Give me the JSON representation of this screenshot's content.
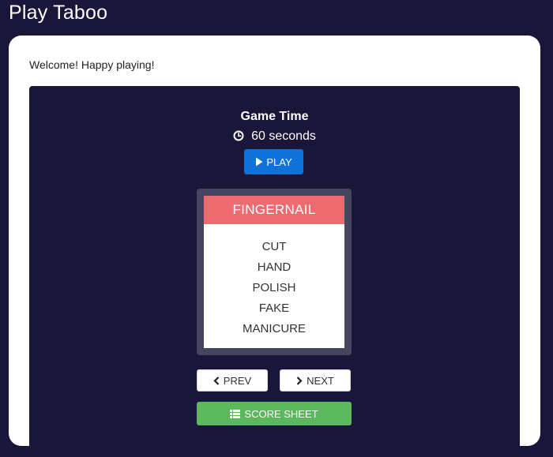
{
  "app": {
    "title": "Play Taboo"
  },
  "welcome_message": "Welcome! Happy playing!",
  "game_time": {
    "title": "Game Time",
    "value": "60 seconds"
  },
  "buttons": {
    "play": "PLAY",
    "prev": "PREV",
    "next": "NEXT",
    "score_sheet": "SCORE SHEET"
  },
  "card": {
    "word": "FINGERNAIL",
    "forbidden": [
      "CUT",
      "HAND",
      "POLISH",
      "FAKE",
      "MANICURE"
    ]
  },
  "icons": {
    "clock": "clock-icon",
    "play": "play-icon",
    "prev": "chevron-left-icon",
    "next": "chevron-right-icon",
    "score_sheet": "table-icon"
  },
  "colors": {
    "background": "#191639",
    "card_header": "#ef6a71",
    "play_button": "#0f72d8",
    "score_button": "#5cb85c"
  }
}
